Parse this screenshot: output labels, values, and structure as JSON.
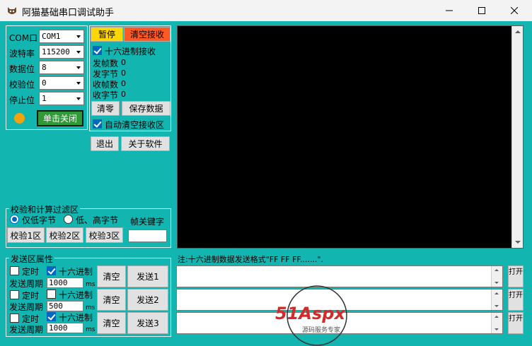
{
  "window": {
    "title": "阿猫基础串口调试助手",
    "icon": "cat-icon"
  },
  "serial": {
    "port_label": "COM口",
    "port_value": "COM1",
    "baud_label": "波特率",
    "baud_value": "115200",
    "databits_label": "数据位",
    "databits_value": "8",
    "parity_label": "校验位",
    "parity_value": "0",
    "stopbits_label": "停止位",
    "stopbits_value": "1",
    "open_button": "单击关闭",
    "status_color": "#f2a30f"
  },
  "receive_ctrl": {
    "pause_button": "暂停",
    "clear_receive_button": "清空接收",
    "hex_receive_label": "十六进制接收",
    "hex_receive_checked": true,
    "sent_frames_label": "发帧数",
    "sent_frames_value": "0",
    "sent_bytes_label": "发字节",
    "sent_bytes_value": "0",
    "recv_frames_label": "收帧数",
    "recv_frames_value": "0",
    "recv_bytes_label": "收字节",
    "recv_bytes_value": "0",
    "zero_button": "清零",
    "save_button": "保存数据",
    "auto_clear_label": "自动清空接收区",
    "auto_clear_checked": true
  },
  "misc": {
    "exit_button": "退出",
    "about_button": "关于软件"
  },
  "checksum": {
    "group_title": "校验和计算过滤区",
    "low_byte_label": "仅低字节",
    "low_high_label": "低、高字节",
    "frame_key_label": "帧关键字",
    "frame_key_value": "",
    "check1_button": "校验1区",
    "check2_button": "校验2区",
    "check3_button": "校验3区"
  },
  "send_props": {
    "group_title": "发送区属性",
    "rows": [
      {
        "timer_label": "定时",
        "timer_checked": false,
        "hex_label": "十六进制",
        "hex_checked": true,
        "period_label": "发送周期",
        "period_value": "1000",
        "unit": "ms",
        "clear_button": "清空",
        "send_button": "发送1",
        "open_button": "打开"
      },
      {
        "timer_label": "定时",
        "timer_checked": false,
        "hex_label": "十六进制",
        "hex_checked": false,
        "period_label": "发送周期",
        "period_value": "500",
        "unit": "ms",
        "clear_button": "清空",
        "send_button": "发送2",
        "open_button": "打开"
      },
      {
        "timer_label": "定时",
        "timer_checked": false,
        "hex_label": "十六进制",
        "hex_checked": true,
        "period_label": "发送周期",
        "period_value": "1000",
        "unit": "ms",
        "clear_button": "清空",
        "send_button": "发送3",
        "open_button": "打开"
      }
    ]
  },
  "send_area": {
    "hint": "注:十六进制数据发送格式\"FF FF FF.......\"."
  },
  "watermark": {
    "brand": "51Aspx",
    "tagline": "源码服务专家"
  },
  "colors": {
    "client_bg": "#13b5b0",
    "pause_bg": "#ffd700",
    "clear_bg": "#ff5a23",
    "open_bg": "#2f9a37",
    "receive_bg": "#000000"
  }
}
